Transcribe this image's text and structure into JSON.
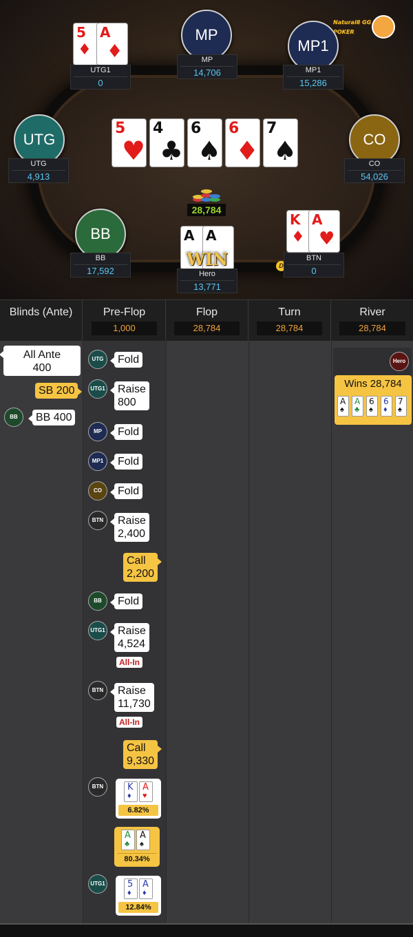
{
  "table": {
    "logo_text": "Natural8 GG POKER",
    "pot": "28,784",
    "win_label": "WIN",
    "dealer_label": "D",
    "board": [
      {
        "rank": "5",
        "suit": "♥",
        "color": "red"
      },
      {
        "rank": "4",
        "suit": "♣",
        "color": "blk"
      },
      {
        "rank": "6",
        "suit": "♠",
        "color": "blk"
      },
      {
        "rank": "6",
        "suit": "♦",
        "color": "red"
      },
      {
        "rank": "7",
        "suit": "♠",
        "color": "blk"
      }
    ],
    "seats": {
      "utg1": {
        "name": "UTG1",
        "stack": "0",
        "cards": [
          {
            "rank": "5",
            "suit": "♦"
          },
          {
            "rank": "A",
            "suit": "♦"
          }
        ]
      },
      "mp": {
        "label": "MP",
        "name": "MP",
        "stack": "14,706"
      },
      "mp1": {
        "label": "MP1",
        "name": "MP1",
        "stack": "15,286"
      },
      "utg": {
        "label": "UTG",
        "name": "UTG",
        "stack": "4,913"
      },
      "co": {
        "label": "CO",
        "name": "CO",
        "stack": "54,026"
      },
      "bb": {
        "label": "BB",
        "name": "BB",
        "stack": "17,592"
      },
      "hero": {
        "name": "Hero",
        "stack": "13,771",
        "cards": [
          {
            "rank": "A",
            "suit": "♠"
          },
          {
            "rank": "A",
            "suit": "♣"
          }
        ]
      },
      "btn": {
        "name": "BTN",
        "stack": "0",
        "cards": [
          {
            "rank": "K",
            "suit": "♦"
          },
          {
            "rank": "A",
            "suit": "♥"
          }
        ]
      }
    }
  },
  "history": {
    "columns": [
      {
        "title": "Blinds (Ante)",
        "pot": ""
      },
      {
        "title": "Pre-Flop",
        "pot": "1,000"
      },
      {
        "title": "Flop",
        "pot": "28,784"
      },
      {
        "title": "Turn",
        "pot": "28,784"
      },
      {
        "title": "River",
        "pot": "28,784"
      }
    ],
    "blinds": {
      "ante": "All Ante\n400",
      "ante_l1": "All Ante",
      "ante_l2": "400",
      "sb": "SB 200",
      "bb_avatar": "BB",
      "bb": "BB 400"
    },
    "preflop": [
      {
        "avatar": "UTG",
        "action": "Fold"
      },
      {
        "avatar": "UTG1",
        "l1": "Raise",
        "l2": "800"
      },
      {
        "avatar": "MP",
        "action": "Fold"
      },
      {
        "avatar": "MP1",
        "action": "Fold"
      },
      {
        "avatar": "CO",
        "action": "Fold"
      },
      {
        "avatar": "BTN",
        "l1": "Raise",
        "l2": "2,400"
      },
      {
        "hero": true,
        "l1": "Call",
        "l2": "2,200"
      },
      {
        "avatar": "BB",
        "action": "Fold"
      },
      {
        "avatar": "UTG1",
        "l1": "Raise",
        "l2": "4,524",
        "allin": "All-In"
      },
      {
        "avatar": "BTN",
        "l1": "Raise",
        "l2": "11,730",
        "allin": "All-In"
      },
      {
        "hero": true,
        "l1": "Call",
        "l2": "9,330"
      }
    ],
    "showdown": [
      {
        "avatar": "BTN",
        "cards": [
          {
            "rank": "K",
            "suit": "♦",
            "color": "blue"
          },
          {
            "rank": "A",
            "suit": "♥",
            "color": "red"
          }
        ],
        "pct": "6.82%"
      },
      {
        "hero": true,
        "cards": [
          {
            "rank": "A",
            "suit": "♣",
            "color": "grn"
          },
          {
            "rank": "A",
            "suit": "♠",
            "color": "blk"
          }
        ],
        "pct": "80.34%"
      },
      {
        "avatar": "UTG1",
        "cards": [
          {
            "rank": "5",
            "suit": "♦",
            "color": "blue"
          },
          {
            "rank": "A",
            "suit": "♦",
            "color": "blue"
          }
        ],
        "pct": "12.84%"
      }
    ],
    "river": {
      "avatar": "Hero",
      "wins": "Wins 28,784",
      "cards": [
        {
          "rank": "A",
          "suit": "♠",
          "color": "blk"
        },
        {
          "rank": "A",
          "suit": "♣",
          "color": "grn"
        },
        {
          "rank": "6",
          "suit": "♠",
          "color": "blk"
        },
        {
          "rank": "6",
          "suit": "♦",
          "color": "blue"
        },
        {
          "rank": "7",
          "suit": "♠",
          "color": "blk"
        }
      ]
    }
  },
  "colors": {
    "utg": "#1f6b67",
    "mp": "#1e2b52",
    "mp1": "#1e2b52",
    "co": "#8a6512",
    "bb": "#2b6a3a",
    "accent_yellow": "#f6c443",
    "stack_blue": "#5cc6f2",
    "pot_green": "#9bd42a"
  }
}
